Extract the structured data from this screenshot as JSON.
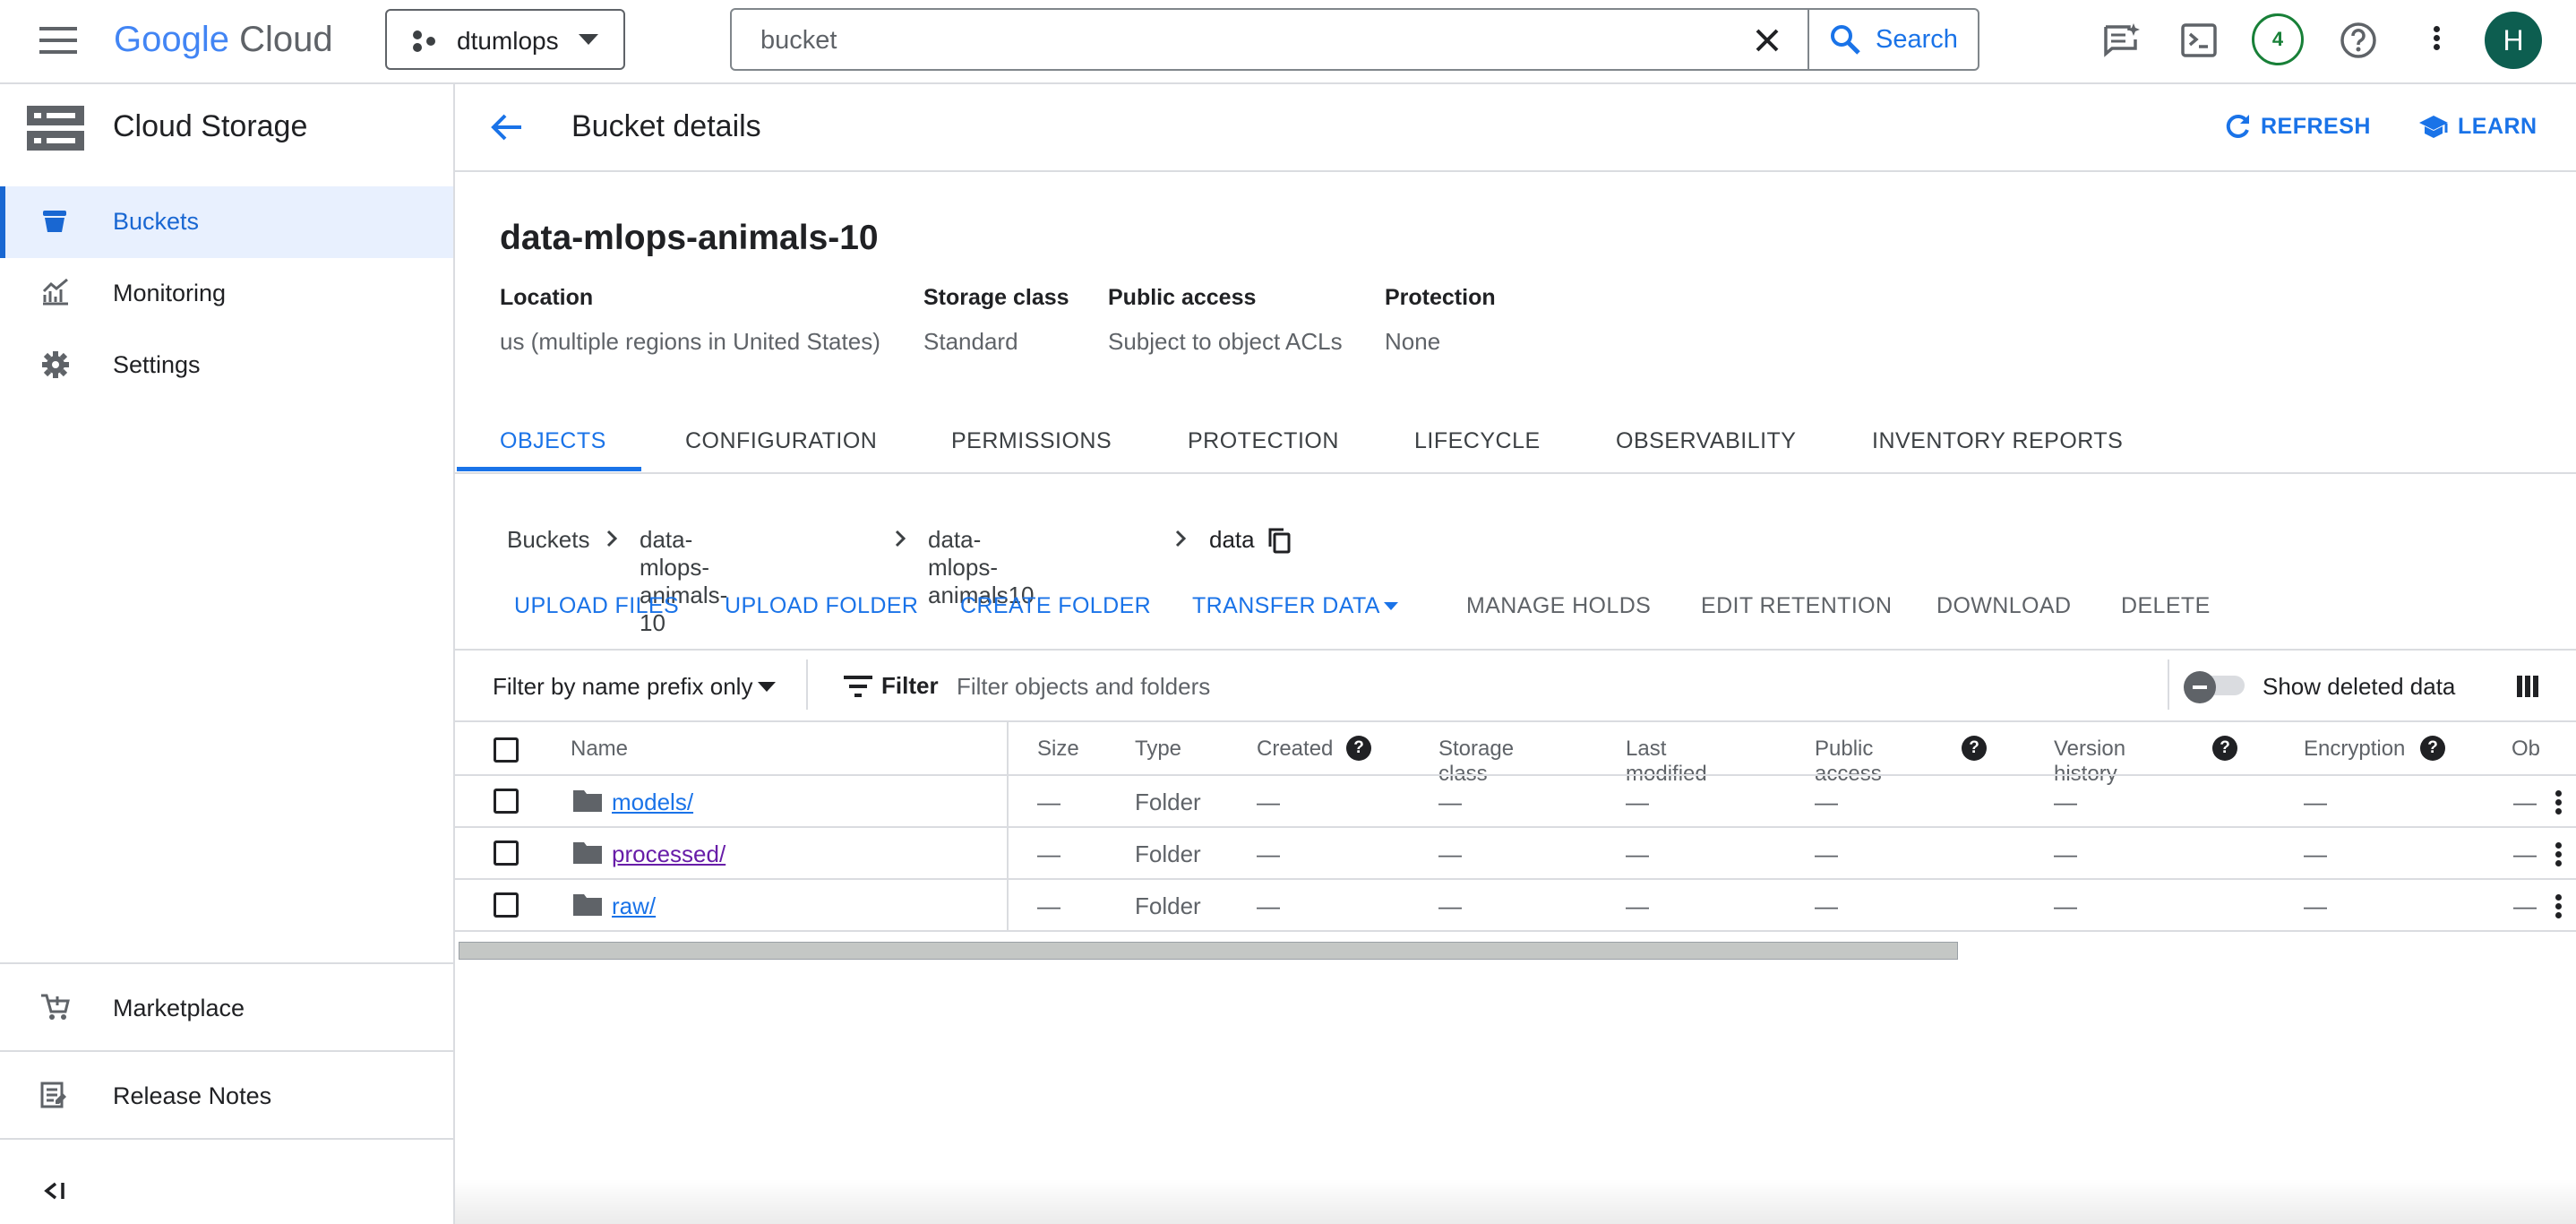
{
  "topbar": {
    "logo_google": "Google",
    "logo_cloud": "Cloud",
    "project": "dtumlops",
    "search_value": "bucket",
    "search_button": "Search",
    "notification_count": "4",
    "avatar_initial": "H"
  },
  "sidebar": {
    "title": "Cloud Storage",
    "items": [
      {
        "label": "Buckets"
      },
      {
        "label": "Monitoring"
      },
      {
        "label": "Settings"
      }
    ],
    "bottom_items": [
      {
        "label": "Marketplace"
      },
      {
        "label": "Release Notes"
      }
    ]
  },
  "header": {
    "title": "Bucket details",
    "refresh": "REFRESH",
    "learn": "LEARN"
  },
  "bucket": {
    "name": "data-mlops-animals-10",
    "info": [
      {
        "label": "Location",
        "value": "us (multiple regions in United States)"
      },
      {
        "label": "Storage class",
        "value": "Standard"
      },
      {
        "label": "Public access",
        "value": "Subject to object ACLs"
      },
      {
        "label": "Protection",
        "value": "None"
      }
    ]
  },
  "tabs": [
    "OBJECTS",
    "CONFIGURATION",
    "PERMISSIONS",
    "PROTECTION",
    "LIFECYCLE",
    "OBSERVABILITY",
    "INVENTORY REPORTS"
  ],
  "breadcrumb": [
    "Buckets",
    "data-mlops-animals-10",
    "data-mlops-animals10",
    "data"
  ],
  "actions": {
    "upload_files": "UPLOAD FILES",
    "upload_folder": "UPLOAD FOLDER",
    "create_folder": "CREATE FOLDER",
    "transfer_data": "TRANSFER DATA",
    "manage_holds": "MANAGE HOLDS",
    "edit_retention": "EDIT RETENTION",
    "download": "DOWNLOAD",
    "delete": "DELETE"
  },
  "filter": {
    "prefix_select": "Filter by name prefix only",
    "filter_label": "Filter",
    "placeholder": "Filter objects and folders",
    "show_deleted": "Show deleted data"
  },
  "table": {
    "columns": [
      "Name",
      "Size",
      "Type",
      "Created",
      "Storage class",
      "Last modified",
      "Public access",
      "Version history",
      "Encryption",
      "Ob"
    ],
    "rows": [
      {
        "name": "models/",
        "size": "—",
        "type": "Folder",
        "created": "—",
        "storage_class": "—",
        "last_modified": "—",
        "public_access": "—",
        "version_history": "—",
        "encryption": "—",
        "ob": "—"
      },
      {
        "name": "processed/",
        "size": "—",
        "type": "Folder",
        "created": "—",
        "storage_class": "—",
        "last_modified": "—",
        "public_access": "—",
        "version_history": "—",
        "encryption": "—",
        "ob": "—"
      },
      {
        "name": "raw/",
        "size": "—",
        "type": "Folder",
        "created": "—",
        "storage_class": "—",
        "last_modified": "—",
        "public_access": "—",
        "version_history": "—",
        "encryption": "—",
        "ob": "—"
      }
    ]
  },
  "colors": {
    "accent": "#1a73e8",
    "visited_link": "#681da8",
    "active_nav_bg": "#e8f0fe",
    "badge_green": "#188038",
    "avatar_bg": "#0d5e50"
  }
}
